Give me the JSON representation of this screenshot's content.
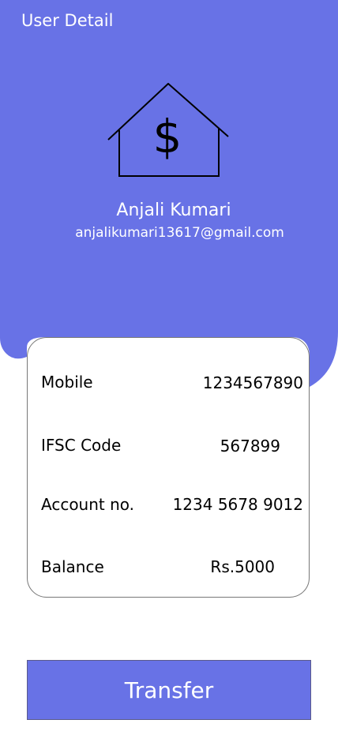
{
  "colors": {
    "header_bg": "#6872e6",
    "button_bg": "#6872e6",
    "text_light": "#ffffff",
    "text_dark": "#000000"
  },
  "header": {
    "title": "User Detail",
    "logo_icon": "house-dollar-icon"
  },
  "user": {
    "name": "Anjali Kumari",
    "email": "anjalikumari13617@gmail.com"
  },
  "details": {
    "mobile_label": "Mobile",
    "mobile_value": "1234567890",
    "ifsc_label": "IFSC Code",
    "ifsc_value": "567899",
    "account_label": "Account no.",
    "account_value": "1234 5678 9012",
    "balance_label": "Balance",
    "balance_value": "Rs.5000"
  },
  "actions": {
    "transfer_label": "Transfer"
  }
}
